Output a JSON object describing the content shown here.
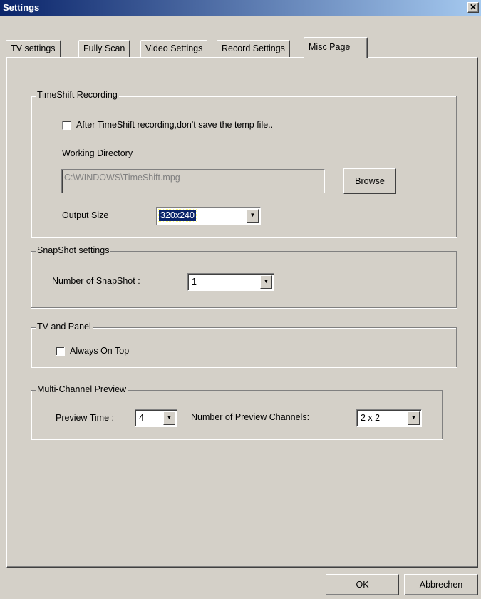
{
  "window": {
    "title": "Settings",
    "close_glyph": "✕"
  },
  "tabs": [
    {
      "label": "TV settings"
    },
    {
      "label": "Fully Scan"
    },
    {
      "label": "Video Settings"
    },
    {
      "label": "Record Settings"
    },
    {
      "label": "Misc Page",
      "active": true
    }
  ],
  "timeshift": {
    "legend": "TimeShift Recording",
    "checkbox_label": "After TimeShift recording,don't save the temp file..",
    "checkbox_checked": false,
    "working_dir_label": "Working Directory",
    "working_dir_value": "C:\\WINDOWS\\TimeShift.mpg",
    "browse_label": "Browse",
    "output_size_label": "Output Size",
    "output_size_value": "320x240"
  },
  "snapshot": {
    "legend": "SnapShot settings",
    "number_label": "Number of SnapShot :",
    "number_value": "1"
  },
  "tv_panel": {
    "legend": "TV and Panel",
    "always_on_top_label": "Always On Top",
    "always_on_top_checked": false
  },
  "preview": {
    "legend": "Multi-Channel Preview",
    "time_label": "Preview Time :",
    "time_value": "4",
    "channels_label": "Number of Preview Channels:",
    "channels_value": "2 x 2"
  },
  "footer": {
    "ok_label": "OK",
    "cancel_label": "Abbrechen"
  },
  "icons": {
    "dropdown_arrow": "▼"
  }
}
